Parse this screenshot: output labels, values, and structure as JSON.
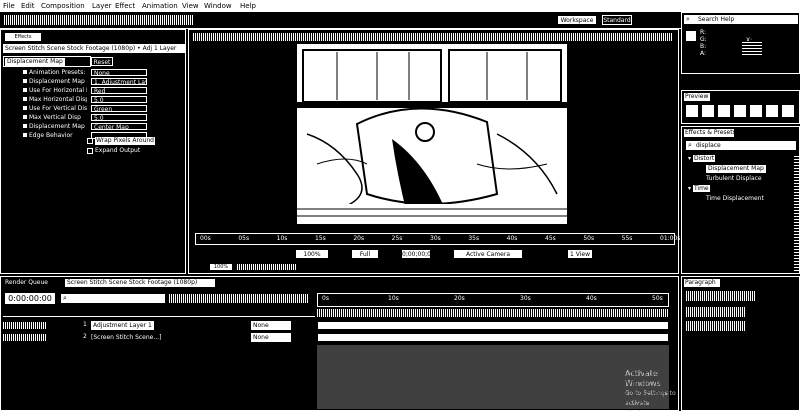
{
  "menu": [
    "File",
    "Edit",
    "Composition",
    "Layer",
    "Effect",
    "Animation",
    "View",
    "Window",
    "Help"
  ],
  "workspace": {
    "label": "Workspace",
    "value": "Standard"
  },
  "search_help": "Search Help",
  "effect_controls": {
    "header": "Screen Stitch Scene Stock Footage (1080p) • Adj 1 Layer",
    "effect_name": "Displacement Map",
    "reset": "Reset",
    "params": [
      {
        "name": "Animation Presets:",
        "value": "None"
      },
      {
        "name": "Displacement Map Layer",
        "value": "1. Adjustment Layer 1"
      },
      {
        "name": "Use For Horizontal D",
        "value": "Red"
      },
      {
        "name": "Max Horizontal Disp",
        "value": "5.0"
      },
      {
        "name": "Use For Vertical Disp",
        "value": "Green"
      },
      {
        "name": "Max Vertical Disp",
        "value": "5.0"
      },
      {
        "name": "Displacement Map B",
        "value": "Center Map"
      },
      {
        "name": "Edge Behavior",
        "value": ""
      }
    ],
    "checkboxes": [
      "Wrap Pixels Around",
      "Expand Output"
    ]
  },
  "viewer": {
    "ruler_ticks": [
      "00s",
      "05s",
      "10s",
      "15s",
      "20s",
      "25s",
      "30s",
      "35s",
      "40s",
      "45s",
      "50s",
      "55s",
      "01:00s"
    ],
    "zoom": "100%",
    "timecode": "0;00;00;00",
    "quality": "Full",
    "view": "Active Camera",
    "views": "1 View"
  },
  "info_panel": {
    "r": "R:",
    "g": "G:",
    "b": "B:",
    "a": "A:",
    "x": "X:",
    "y": "Y:"
  },
  "preview_label": "Preview",
  "effects_presets": {
    "title": "Effects & Presets",
    "search": "displace",
    "category": "Distort",
    "items": [
      "Displacement Map",
      "Turbulent Displace"
    ],
    "category2": "Time",
    "items2": [
      "Time Displacement"
    ]
  },
  "timeline": {
    "tab": "Render Queue",
    "comp_tab": "Screen Stitch Scene Stock Footage (1080p)",
    "timecode": "0:00:00:00",
    "layers": [
      {
        "num": "1",
        "name": "Adjustment Layer 1",
        "parent": "None"
      },
      {
        "num": "2",
        "name": "[Screen Stitch Scene...]",
        "parent": "None"
      }
    ],
    "ruler_marks": [
      "0s",
      "10s",
      "20s",
      "30s",
      "40s",
      "50s"
    ]
  },
  "paragraph_panel": {
    "title": "Paragraph"
  },
  "watermark": {
    "line1": "Activate Windows",
    "line2": "Go to Settings to activate Windows."
  }
}
